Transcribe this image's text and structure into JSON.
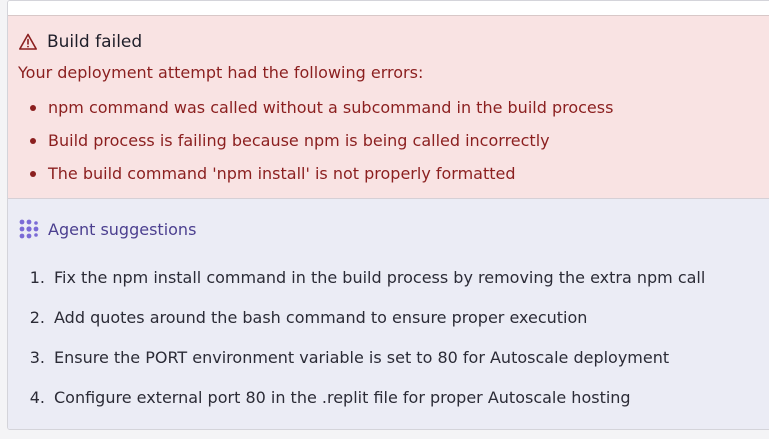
{
  "error": {
    "title": "Build failed",
    "intro": "Your deployment attempt had the following errors:",
    "items": [
      "npm command was called without a subcommand in the build process",
      "Build process is failing because npm is being called incorrectly",
      "The build command 'npm install' is not properly formatted"
    ],
    "icon": "warning-triangle-icon",
    "color": "#8b1f1f",
    "background": "#f9e3e3"
  },
  "suggestions": {
    "title": "Agent suggestions",
    "icon": "agent-icon",
    "accent": "#7b6bd6",
    "background": "#ebecf5",
    "items": [
      {
        "number": "1.",
        "text": "Fix the npm install command in the build process by removing the extra npm call"
      },
      {
        "number": "2.",
        "text": "Add quotes around the bash command to ensure proper execution"
      },
      {
        "number": "3.",
        "text": "Ensure the PORT environment variable is set to 80 for Autoscale deployment"
      },
      {
        "number": "4.",
        "text": "Configure external port 80 in the .replit file for proper Autoscale hosting"
      }
    ]
  }
}
